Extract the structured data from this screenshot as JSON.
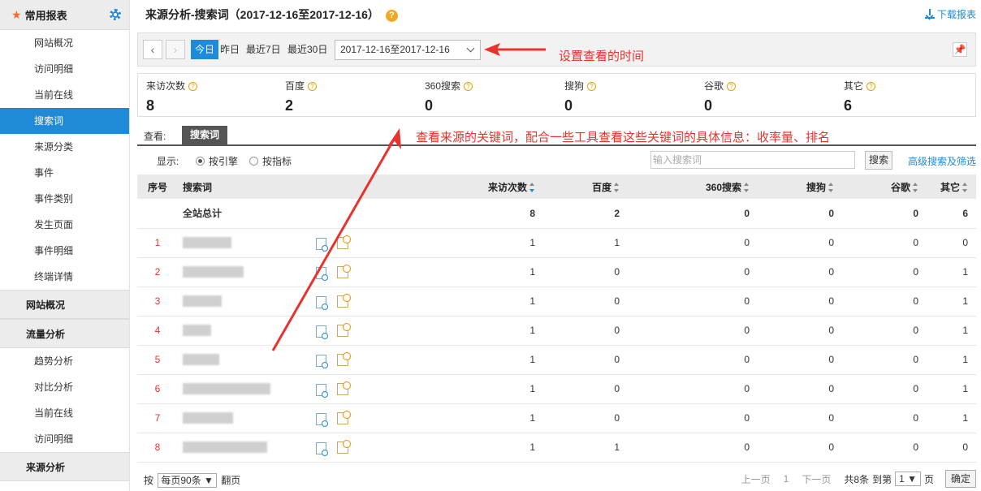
{
  "sidebar": {
    "header": "常用报表",
    "items": [
      {
        "label": "网站概况",
        "active": false
      },
      {
        "label": "访问明细",
        "active": false
      },
      {
        "label": "当前在线",
        "active": false
      },
      {
        "label": "搜索词",
        "active": true
      },
      {
        "label": "来源分类",
        "active": false
      },
      {
        "label": "事件",
        "active": false
      },
      {
        "label": "事件类别",
        "active": false
      },
      {
        "label": "发生页面",
        "active": false
      },
      {
        "label": "事件明细",
        "active": false
      },
      {
        "label": "终端详情",
        "active": false
      }
    ],
    "group_overview": "网站概况",
    "group_traffic": "流量分析",
    "traffic_items": [
      "趋势分析",
      "对比分析",
      "当前在线",
      "访问明细"
    ],
    "group_source": "来源分析"
  },
  "header": {
    "title": "来源分析-搜索词（2017-12-16至2017-12-16）",
    "help": "?",
    "download": "下载报表"
  },
  "datebar": {
    "today": "今日",
    "yesterday": "昨日",
    "last7": "最近7日",
    "last30": "最近30日",
    "range": "2017-12-16至2017-12-16"
  },
  "annotations": {
    "time_note": "设置查看的时间",
    "keyword_note": "查看来源的关键词，配合一些工具查看这些关键词的具体信息：收率量、排名"
  },
  "metrics": [
    {
      "label": "来访次数",
      "value": "8"
    },
    {
      "label": "百度",
      "value": "2"
    },
    {
      "label": "360搜索",
      "value": "0"
    },
    {
      "label": "搜狗",
      "value": "0"
    },
    {
      "label": "谷歌",
      "value": "0"
    },
    {
      "label": "其它",
      "value": "6"
    }
  ],
  "view": {
    "label": "查看:",
    "tab": "搜索词"
  },
  "filter": {
    "label": "显示:",
    "by_engine": "按引擎",
    "by_metric": "按指标",
    "search_placeholder": "输入搜索词",
    "search_button": "搜索",
    "advanced": "高级搜索及筛选"
  },
  "table": {
    "headers": [
      "序号",
      "搜索词",
      "来访次数",
      "百度",
      "360搜索",
      "搜狗",
      "谷歌",
      "其它"
    ],
    "total": {
      "label": "全站总计",
      "values": [
        "8",
        "2",
        "0",
        "0",
        "0",
        "6"
      ]
    },
    "rows": [
      {
        "idx": "1",
        "values": [
          "1",
          "1",
          "0",
          "0",
          "0",
          "0"
        ]
      },
      {
        "idx": "2",
        "values": [
          "1",
          "0",
          "0",
          "0",
          "0",
          "1"
        ]
      },
      {
        "idx": "3",
        "values": [
          "1",
          "0",
          "0",
          "0",
          "0",
          "1"
        ]
      },
      {
        "idx": "4",
        "values": [
          "1",
          "0",
          "0",
          "0",
          "0",
          "1"
        ]
      },
      {
        "idx": "5",
        "values": [
          "1",
          "0",
          "0",
          "0",
          "0",
          "1"
        ]
      },
      {
        "idx": "6",
        "values": [
          "1",
          "0",
          "0",
          "0",
          "0",
          "1"
        ]
      },
      {
        "idx": "7",
        "values": [
          "1",
          "0",
          "0",
          "0",
          "0",
          "1"
        ]
      },
      {
        "idx": "8",
        "values": [
          "1",
          "1",
          "0",
          "0",
          "0",
          "0"
        ]
      }
    ]
  },
  "footer": {
    "by": "按",
    "per_page": "每页90条 ▼",
    "paging": "翻页",
    "prev": "上一页",
    "page": "1",
    "next": "下一页",
    "total": "共8条",
    "goto": "到第",
    "goto_page": "1 ▼",
    "page_unit": "页",
    "confirm": "确定"
  },
  "colors": {
    "accent": "#1f8ad8",
    "annotation": "#e8322e",
    "index_red": "#e8322e"
  }
}
